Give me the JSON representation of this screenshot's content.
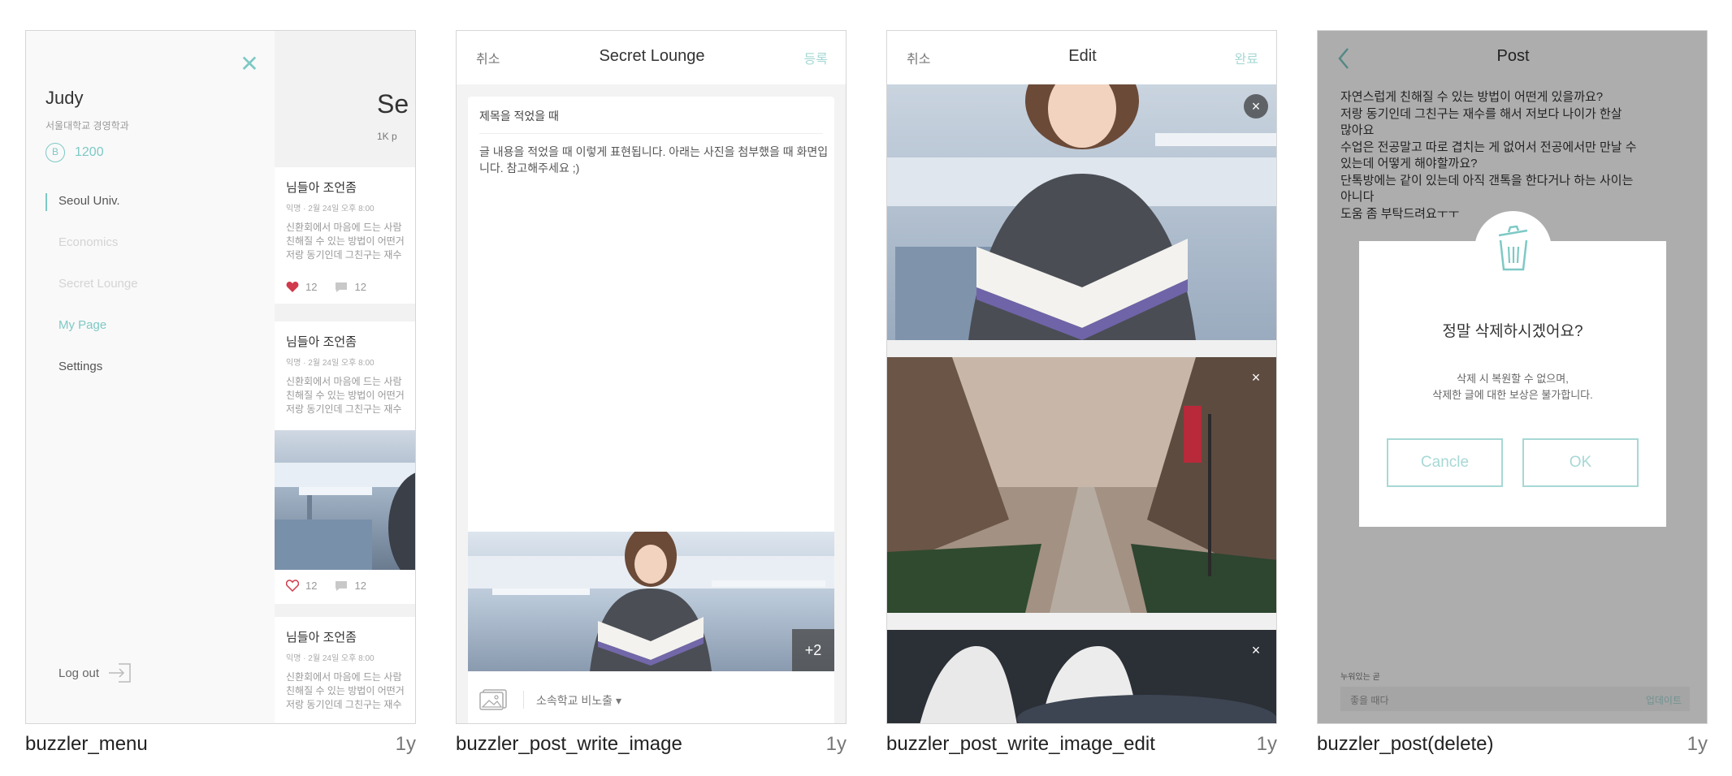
{
  "cards": [
    {
      "label": "buzzler_menu",
      "age": "1y"
    },
    {
      "label": "buzzler_post_write_image",
      "age": "1y"
    },
    {
      "label": "buzzler_post_write_image_edit",
      "age": "1y"
    },
    {
      "label": "buzzler_post(delete)",
      "age": "1y"
    }
  ],
  "menu": {
    "close_icon": "close-icon",
    "user_name": "Judy",
    "school": "서울대학교 경영학과",
    "badge_letter": "B",
    "points": "1200",
    "nav": [
      "Seoul Univ.",
      "Economics",
      "Secret Lounge",
      "My Page",
      "Settings"
    ],
    "logout": "Log out",
    "feed": {
      "title": "Se",
      "subtitle": "1K p",
      "posts": [
        {
          "title": "님들아 조언좀",
          "meta": "익명 · 2월 24일 오후 8:00",
          "body": "신환회에서 마음에 드는 사람\n친해질 수 있는 방법이 어떤거\n저랑 동기인데 그친구는 재수",
          "likes": "12",
          "comments": "12"
        },
        {
          "title": "님들아 조언좀",
          "meta": "익명 · 2월 24일 오후 8:00",
          "body": "신환회에서 마음에 드는 사람\n친해질 수 있는 방법이 어떤거\n저랑 동기인데 그친구는 재수",
          "likes": "12",
          "comments": "12"
        },
        {
          "title": "님들아 조언좀",
          "meta": "익명 · 2월 24일 오후 8:00",
          "body": "신환회에서 마음에 드는 사람\n친해질 수 있는 방법이 어떤거\n저랑 동기인데 그친구는 재수"
        }
      ]
    }
  },
  "write": {
    "cancel": "취소",
    "title": "Secret Lounge",
    "submit": "등록",
    "subject": "제목을 적었을 때",
    "body": "글 내용을 적었을 때 이렇게 표현됩니다. 아래는 사진을 첨부했을 때 화면입니다. 참고해주세요 ;)",
    "more_photos": "+2",
    "visibility": "소속학교 비노출 ▾"
  },
  "edit": {
    "cancel": "취소",
    "title": "Edit",
    "done": "완료"
  },
  "post": {
    "title": "Post",
    "text": "자연스럽게 친해질 수 있는 방법이 어떤게 있을까요?\n저랑 동기인데 그친구는 재수를 해서 저보다 나이가 한살\n많아요\n수업은 전공말고 따로 겹치는 게 없어서 전공에서만 만날 수\n있는데 어떻게 해야할까요?\n단톡방에는 같이 있는데 아직 갠톡을 한다거나 하는 사이는\n아니다\n도움 좀 부탁드려요ㅜㅜ",
    "footer_label": "누워있는 곧",
    "footer_placeholder": "좋을 때다",
    "footer_action": "업데이트",
    "dialog": {
      "title": "정말 삭제하시겠어요?",
      "message": "삭제 시 복원할 수 없으며,\n삭제한 글에 대한 보상은 불가합니다.",
      "cancel": "Cancle",
      "ok": "OK"
    }
  }
}
